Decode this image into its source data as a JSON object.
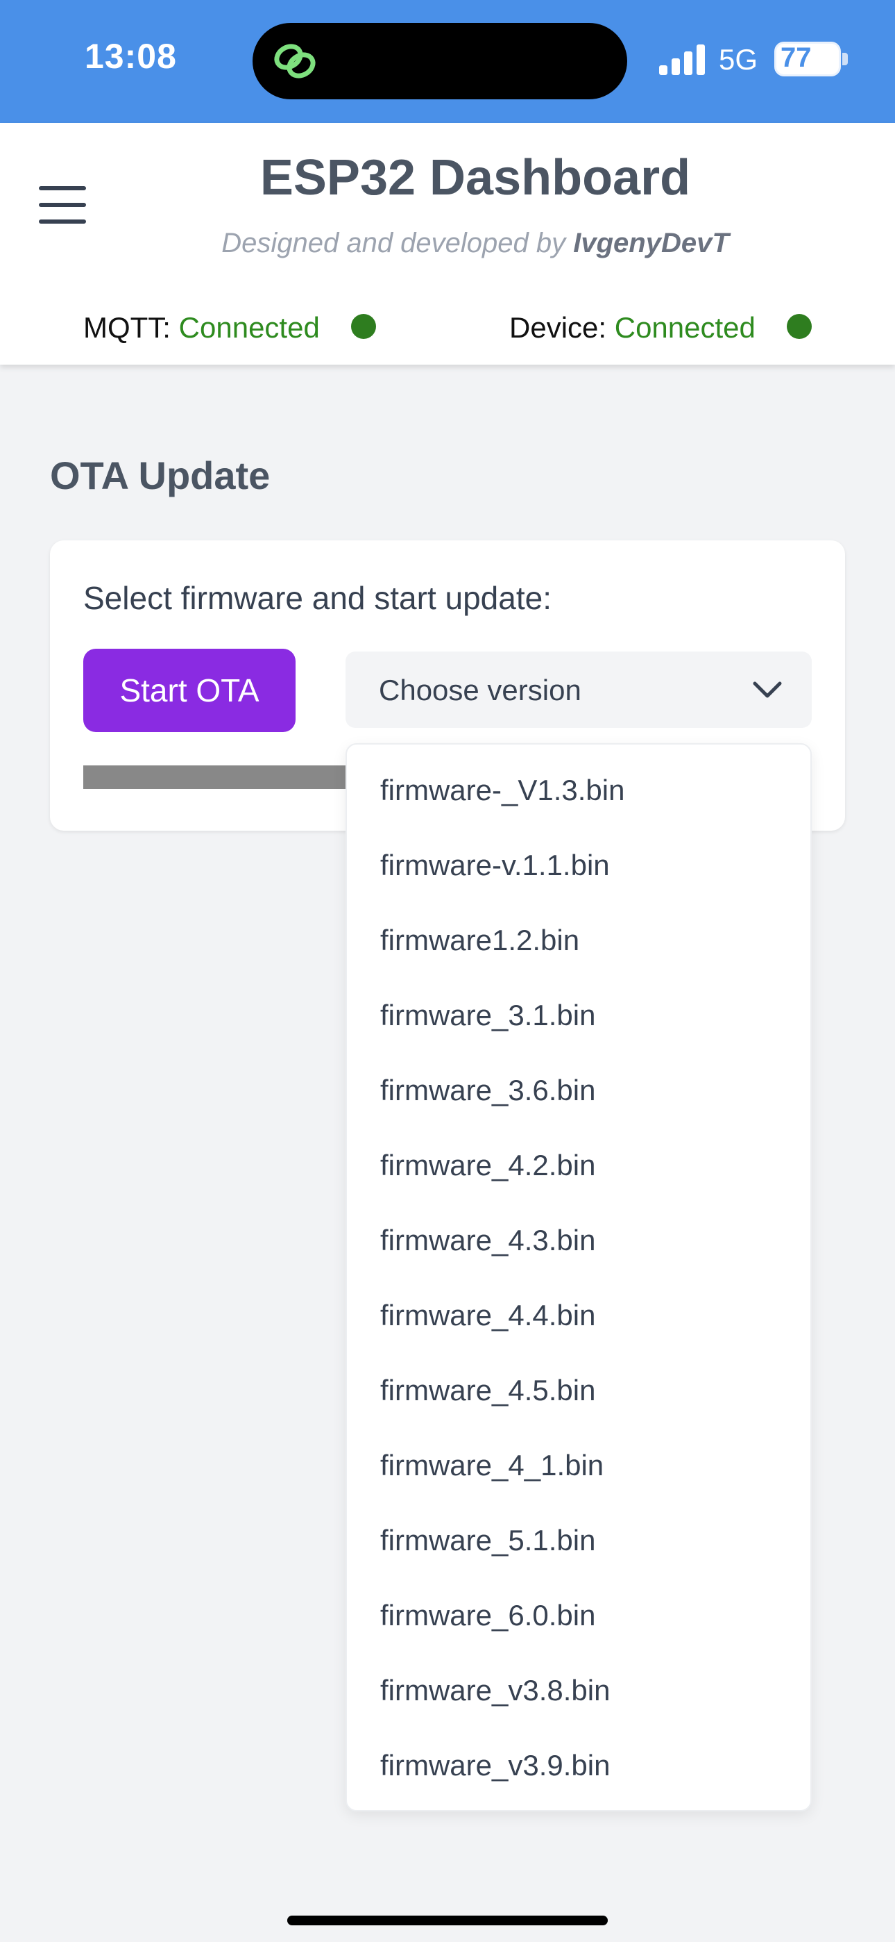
{
  "status_bar": {
    "time": "13:08",
    "network": "5G",
    "battery": "77"
  },
  "header": {
    "title": "ESP32 Dashboard",
    "subtitle_prefix": "Designed and developed by ",
    "subtitle_author": "IvgenyDevT",
    "mqtt": {
      "label": "MQTT:",
      "status": "Connected",
      "status_color": "#2e8b1f"
    },
    "device": {
      "label": "Device:",
      "status": "Connected",
      "status_color": "#2e8b1f"
    }
  },
  "ota": {
    "section_title": "OTA Update",
    "card_label": "Select firmware and start update:",
    "start_button": "Start OTA",
    "select_placeholder": "Choose version",
    "options": [
      "firmware-_V1.3.bin",
      "firmware-v.1.1.bin",
      "firmware1.2.bin",
      "firmware_3.1.bin",
      "firmware_3.6.bin",
      "firmware_4.2.bin",
      "firmware_4.3.bin",
      "firmware_4.4.bin",
      "firmware_4.5.bin",
      "firmware_4_1.bin",
      "firmware_5.1.bin",
      "firmware_6.0.bin",
      "firmware_v3.8.bin",
      "firmware_v3.9.bin"
    ]
  },
  "colors": {
    "status_bar": "#4a90e8",
    "accent_button": "#8a2be2",
    "connected_dot": "#2e7d1f"
  },
  "icons": [
    "link-icon",
    "signal-icon",
    "battery-icon",
    "menu-icon",
    "chevron-down-icon"
  ]
}
